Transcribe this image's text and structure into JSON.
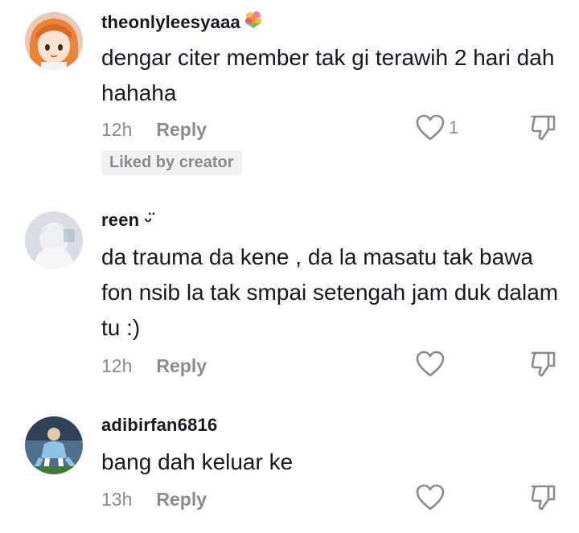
{
  "comments": [
    {
      "username": "theonlyleesyaaa",
      "username_emoji": "bouquet-icon",
      "text": "dengar citer member tak gi terawih 2 hari dah hahaha",
      "time": "12h",
      "reply_label": "Reply",
      "like_count": "1",
      "badge": "Liked by creator"
    },
    {
      "username": "reen",
      "username_suffix": "ᵕ̈",
      "text": "da trauma da kene , da la masatu tak bawa fon nsib la tak smpai setengah jam duk dalam tu :)",
      "time": "12h",
      "reply_label": "Reply"
    },
    {
      "username": "adibirfan6816",
      "text": "bang dah keluar ke",
      "time": "13h",
      "reply_label": "Reply"
    }
  ],
  "colors": {
    "text_primary": "#161823",
    "text_secondary": "#8a8b91",
    "badge_bg": "#f1f1f2"
  }
}
